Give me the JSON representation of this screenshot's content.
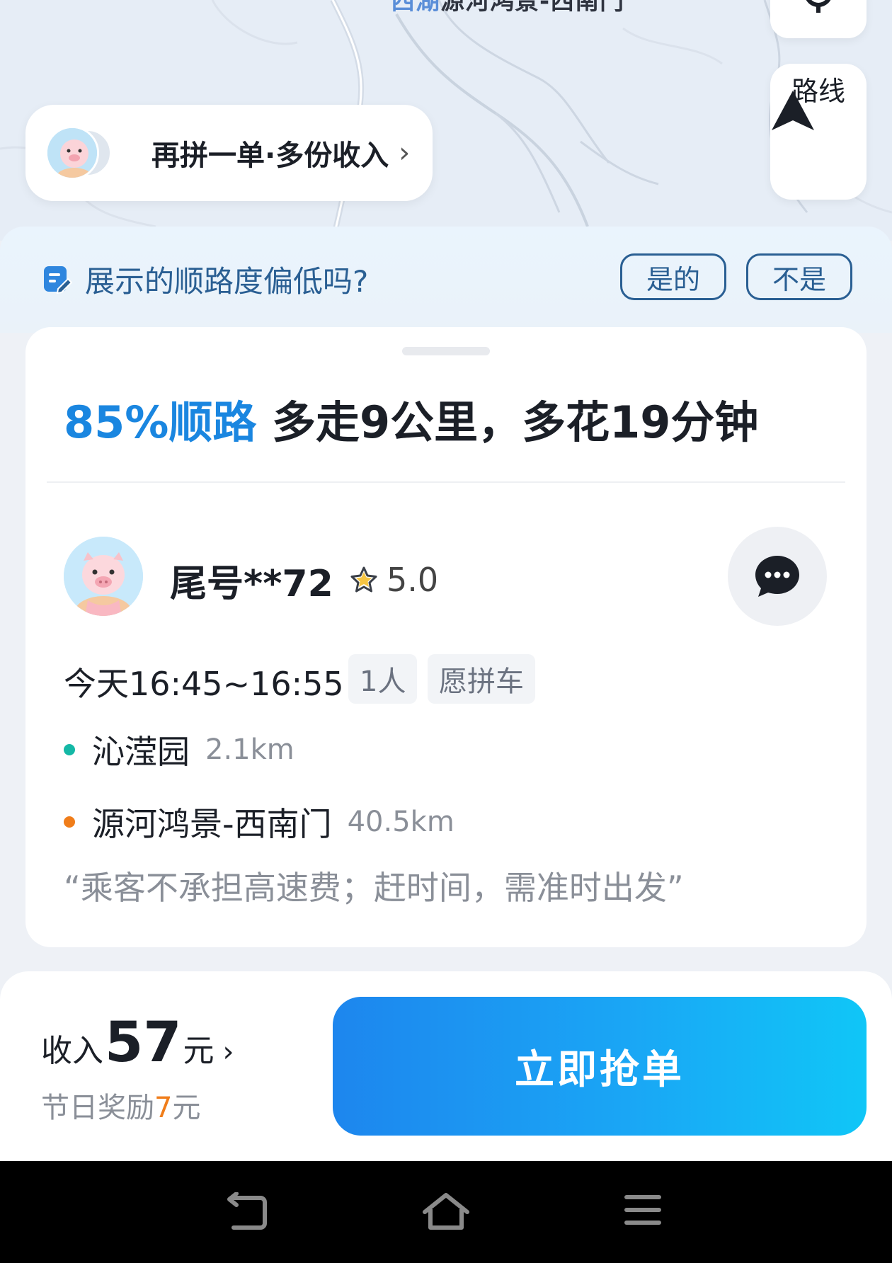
{
  "map": {
    "top_label_prefix": "西湖",
    "top_label": "源河鸿景-西南门"
  },
  "route_button": {
    "label": "路线"
  },
  "pool_prompt": {
    "text": "再拼一单·多份收入",
    "chevron": "›"
  },
  "feedback": {
    "question": "展示的顺路度偏低吗?",
    "yes_label": "是的",
    "no_label": "不是"
  },
  "order": {
    "match_percent": "85%顺路",
    "detour_text": "多走9公里，多花19分钟",
    "rider": {
      "name": "尾号**72",
      "rating": "5.0"
    },
    "time_window": "今天16:45~16:55",
    "tags": [
      "1人",
      "愿拼车"
    ],
    "pickup": {
      "name": "沁滢园",
      "distance": "2.1km"
    },
    "dropoff": {
      "name": "源河鸿景-西南门",
      "distance": "40.5km"
    },
    "note": "“乘客不承担高速费；赶时间，需准时出发”"
  },
  "income": {
    "prefix": "收入",
    "amount": "57",
    "unit": "元",
    "chevron": "›",
    "bonus_prefix": "节日奖励",
    "bonus_amount": "7",
    "bonus_unit": "元"
  },
  "grab_button": {
    "label": "立即抢单"
  },
  "colors": {
    "accent_blue": "#1a86e0",
    "feedback_blue": "#2a5f93",
    "pickup_dot": "#14b8a6",
    "dropoff_dot": "#f07d1a",
    "bonus_orange": "#f07d1a"
  },
  "icons": {
    "route": "navigation-arrow-icon",
    "locate": "location-pin-icon",
    "feedback": "edit-note-icon",
    "rating": "star-outline-icon",
    "chat": "chat-bubble-icon",
    "nav_back": "back-icon",
    "nav_home": "home-icon",
    "nav_menu": "menu-icon"
  }
}
